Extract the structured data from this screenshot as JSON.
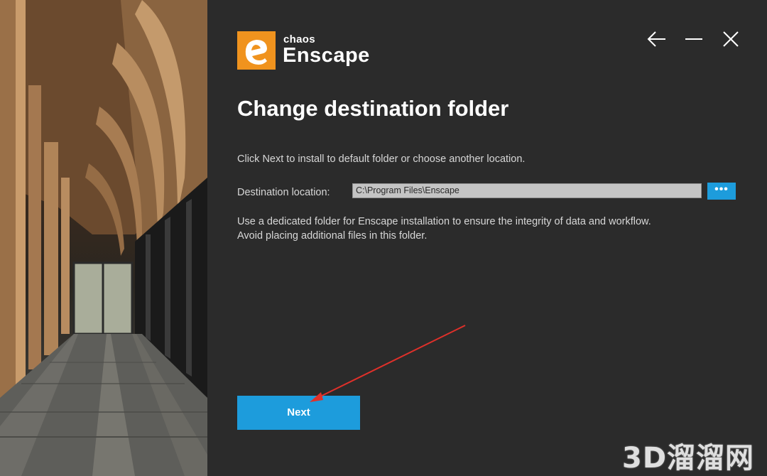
{
  "window": {
    "brand_small": "chaos",
    "brand_name": "Enscape",
    "controls": [
      "back-icon",
      "minimize-icon",
      "close-icon"
    ]
  },
  "page": {
    "title": "Change destination folder",
    "instruction": "Click Next to install to default folder or choose another location.",
    "destination_label": "Destination location:",
    "destination_value": "C:\\Program Files\\Enscape",
    "browse_label": "•••",
    "note_line1": "Use a dedicated folder for Enscape installation to ensure the integrity of data and workflow.",
    "note_line2": "Avoid placing additional files in this folder.",
    "next_label": "Next"
  },
  "watermark": "3D溜溜网",
  "colors": {
    "background": "#2b2b2b",
    "accent_blue": "#1d9cdc",
    "logo_orange": "#f0931e",
    "annotation_arrow": "#e0302a"
  }
}
